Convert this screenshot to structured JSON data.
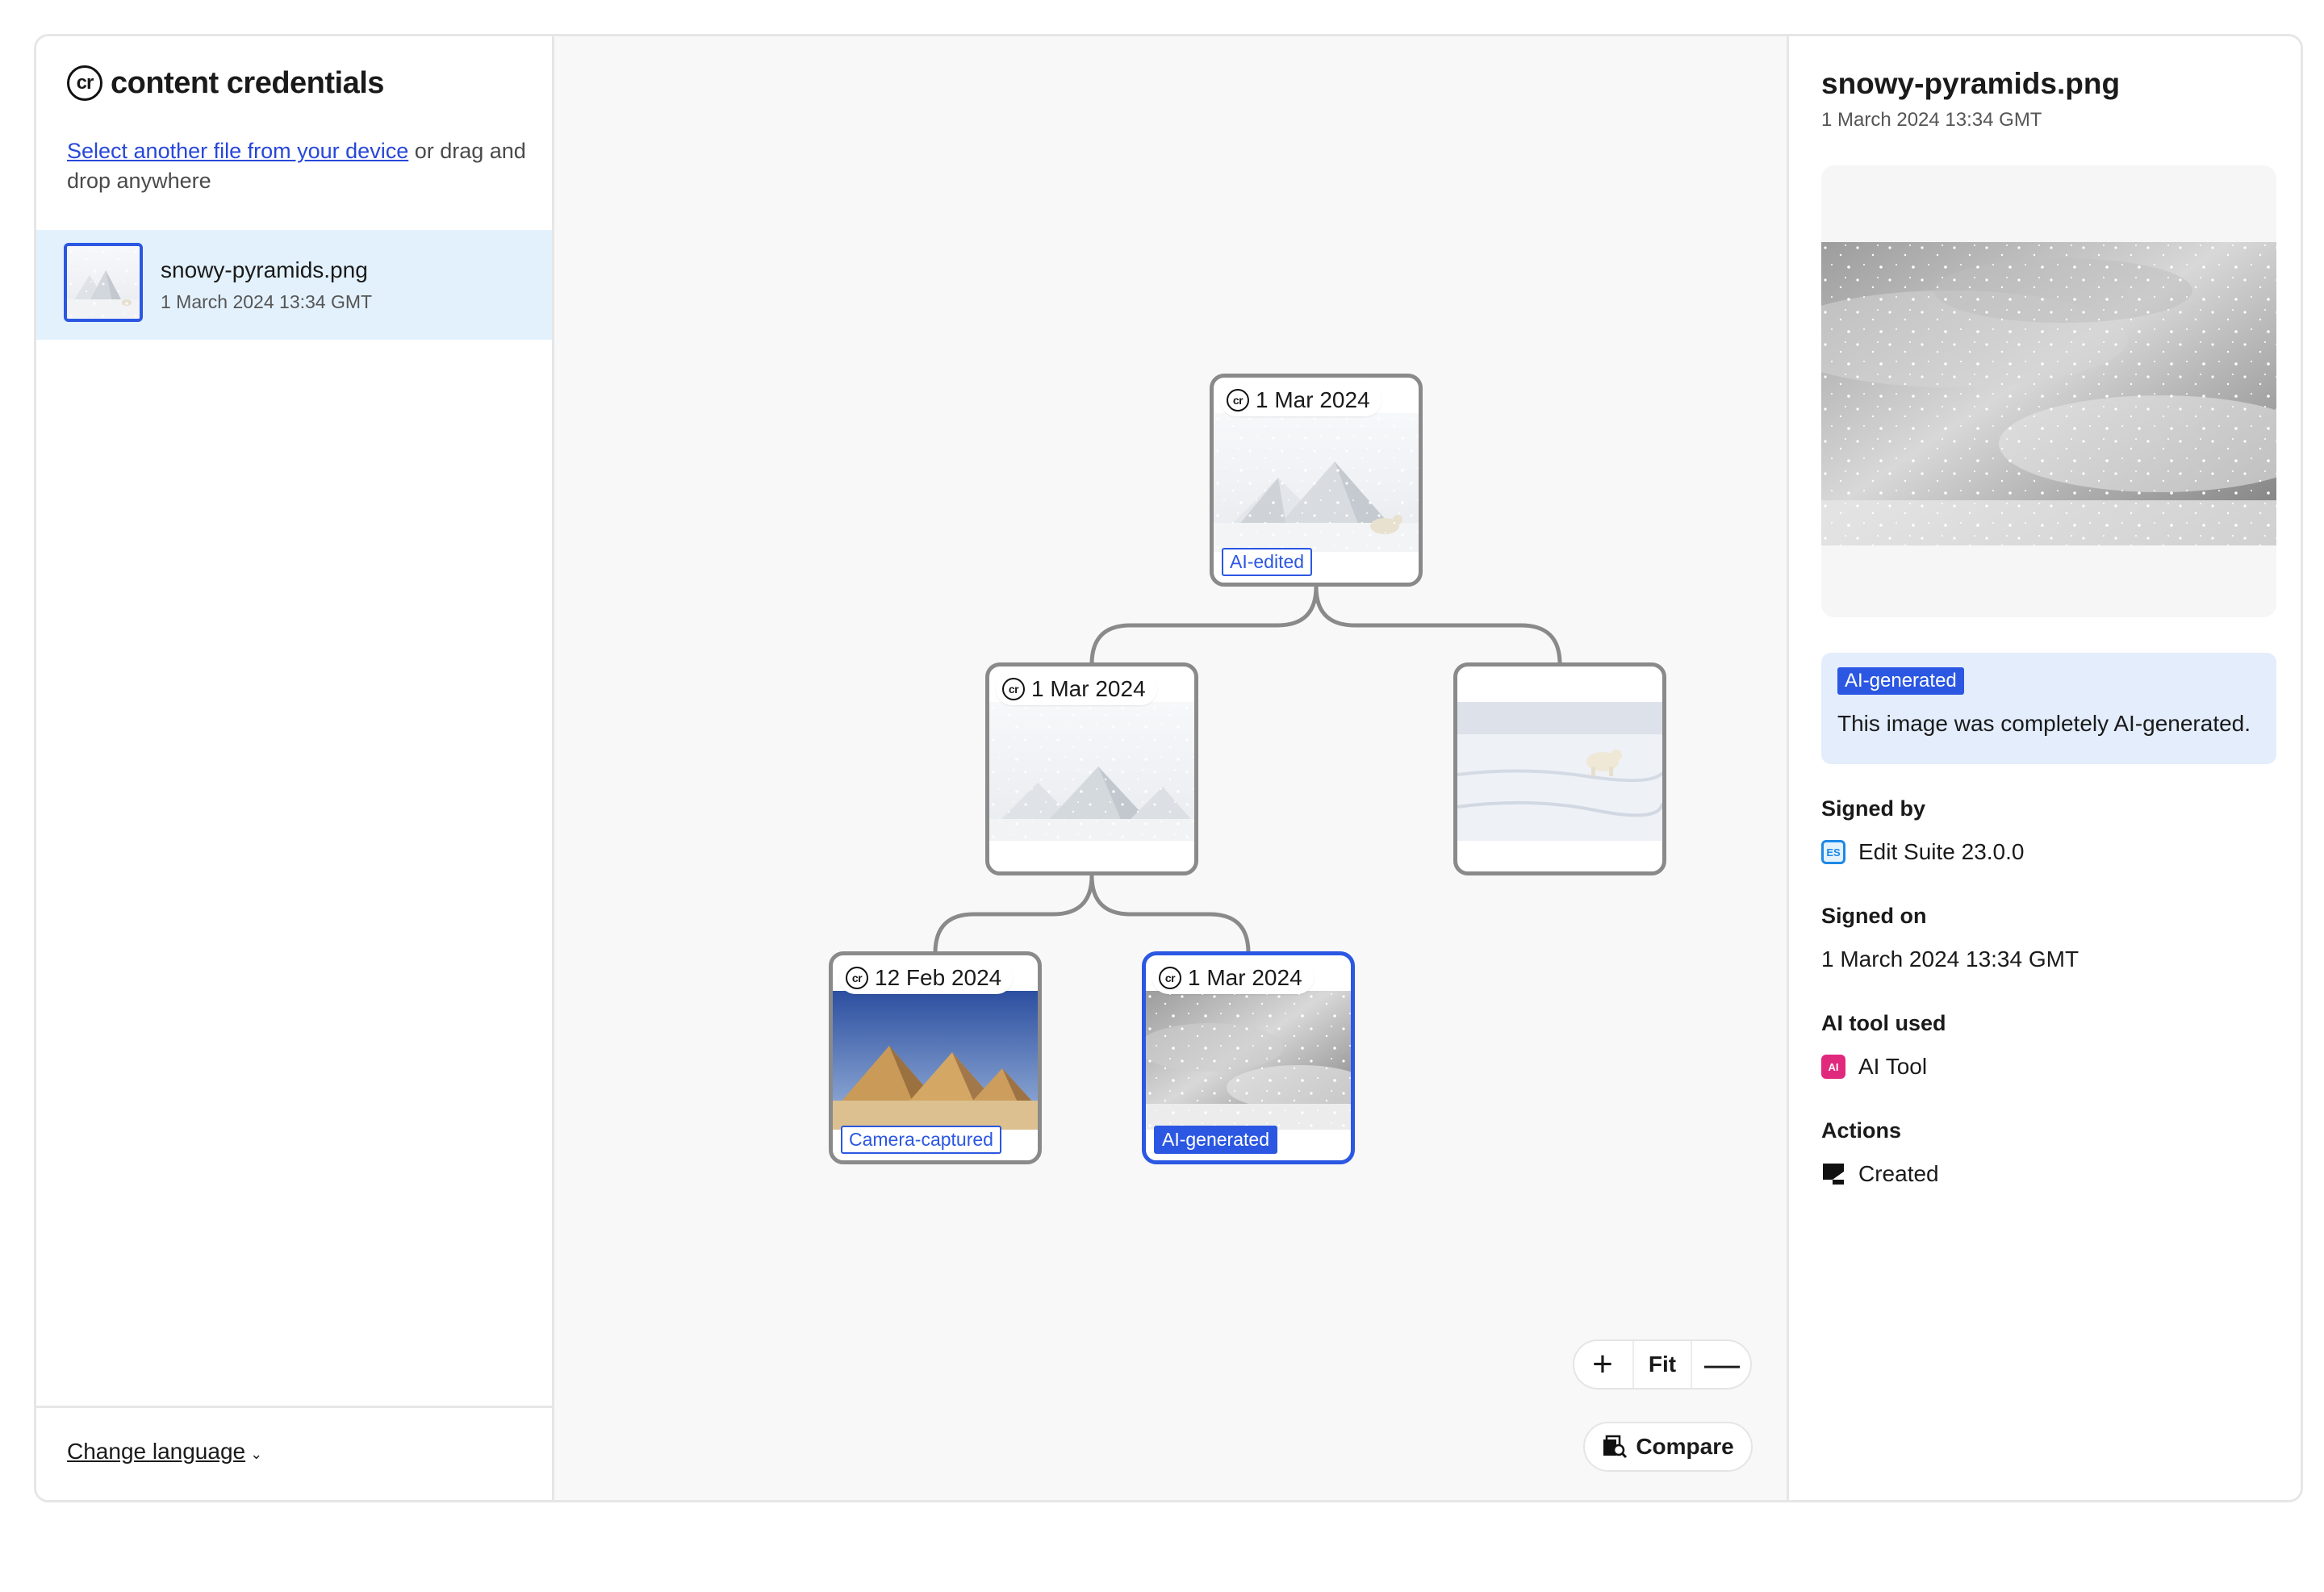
{
  "sidebar": {
    "brand": "content credentials",
    "select_link": "Select another file from your device",
    "select_rest": " or drag and drop anywhere",
    "file": {
      "name": "snowy-pyramids.png",
      "date": "1 March 2024 13:34 GMT"
    },
    "change_language": "Change language"
  },
  "tree": {
    "nodes": [
      {
        "date": "1 Mar 2024",
        "tag": "AI-edited"
      },
      {
        "date": "1 Mar 2024"
      },
      {
        "date": ""
      },
      {
        "date": "12 Feb 2024",
        "tag": "Camera-captured"
      },
      {
        "date": "1 Mar 2024",
        "tag": "AI-generated"
      }
    ]
  },
  "controls": {
    "zoom_in": "+",
    "fit": "Fit",
    "zoom_out": "—",
    "compare": "Compare"
  },
  "details": {
    "title": "snowy-pyramids.png",
    "date": "1 March 2024 13:34 GMT",
    "badge": "AI-generated",
    "badge_desc": "This image was completely AI-generated.",
    "signed_by_label": "Signed by",
    "signed_by_value": "Edit Suite 23.0.0",
    "signed_by_icon": "ES",
    "signed_on_label": "Signed on",
    "signed_on_value": "1 March 2024 13:34 GMT",
    "ai_tool_label": "AI tool used",
    "ai_tool_value": "AI Tool",
    "ai_tool_icon": "AI",
    "actions_label": "Actions",
    "action_value": "Created"
  },
  "colors": {
    "accent": "#2b57e2",
    "selected_bg": "#e3f1fc",
    "ai_box_bg": "#e3edfb",
    "ai_icon": "#e0287d"
  }
}
